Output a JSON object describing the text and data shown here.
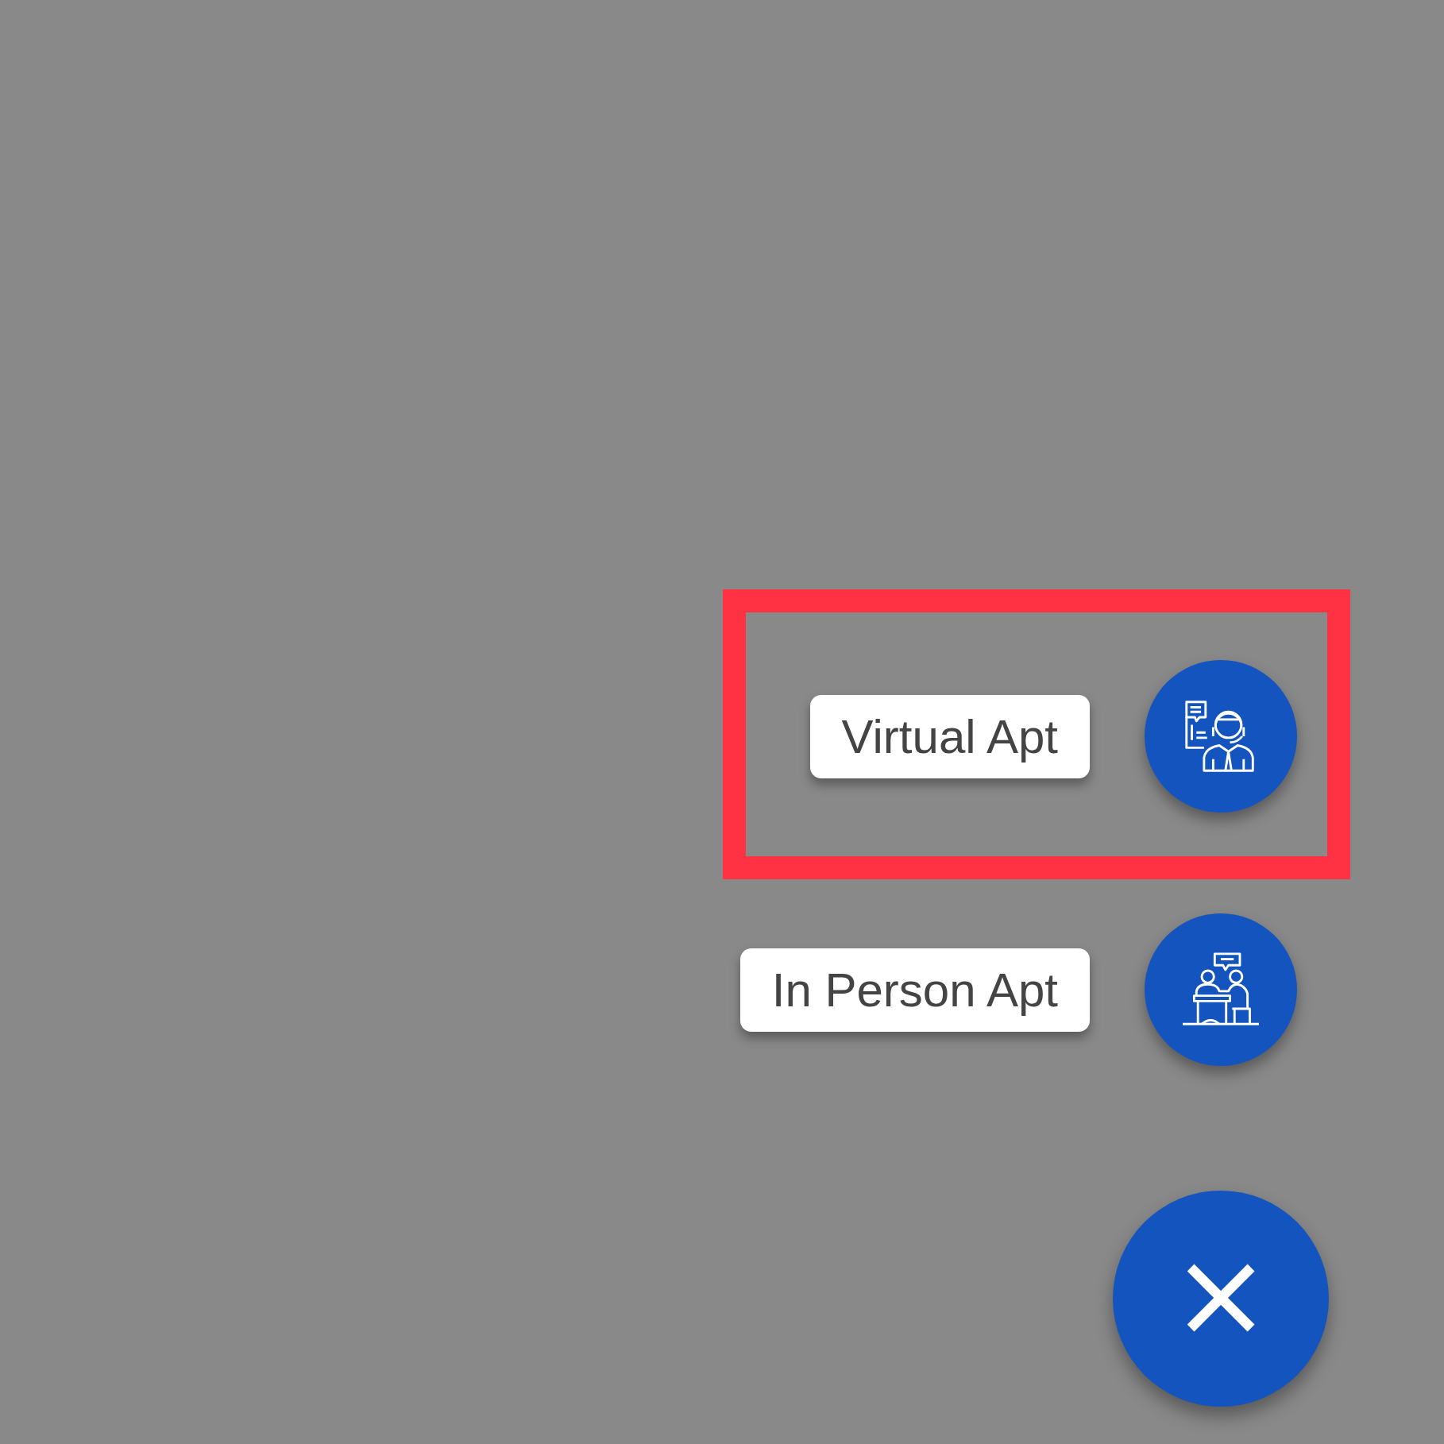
{
  "actions": [
    {
      "label": "Virtual Apt",
      "kind": "virtual",
      "highlighted": true
    },
    {
      "label": "In Person Apt",
      "kind": "in_person",
      "highlighted": false
    }
  ],
  "close_button": {
    "label": "×"
  }
}
